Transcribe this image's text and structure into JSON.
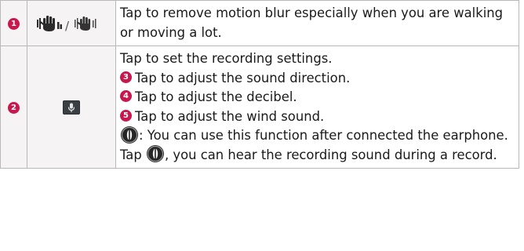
{
  "rows": [
    {
      "number": "1",
      "icon": "steady-hand-icon",
      "icon_separator": "/",
      "description": "Tap to remove motion blur especially when you are walking or moving a lot."
    },
    {
      "number": "2",
      "icon": "microphone-icon",
      "lines": {
        "intro": "Tap to set the recording settings.",
        "item3": {
          "number": "3",
          "text": "Tap to adjust the sound direction."
        },
        "item4": {
          "number": "4",
          "text": "Tap to adjust the decibel."
        },
        "item5": {
          "number": "5",
          "text": "Tap to adjust the wind sound."
        },
        "earphone_note": ": You can use this function after connected the earphone.",
        "tap_prefix": "Tap",
        "tap_suffix": ", you can hear the recording sound during a record."
      }
    }
  ],
  "colors": {
    "badge": "#c8174c",
    "border": "#b8b8b8",
    "icon_cell_bg": "#f5f3f3",
    "icon_dark": "#2b2b2b"
  }
}
